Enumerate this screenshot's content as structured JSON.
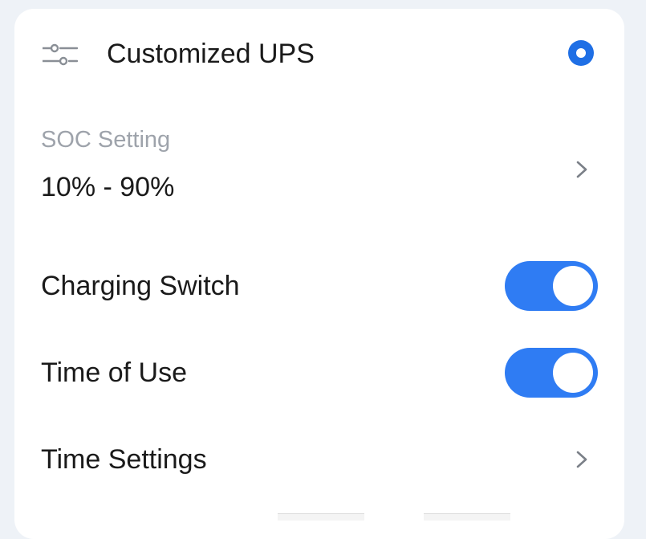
{
  "header": {
    "icon": "sliders-icon",
    "title": "Customized UPS",
    "selected": true,
    "accent_color": "#1f6fe5"
  },
  "soc": {
    "label": "SOC Setting",
    "value": "10% - 90%"
  },
  "charging_switch": {
    "label": "Charging Switch",
    "on": true
  },
  "time_of_use": {
    "label": "Time of Use",
    "on": true
  },
  "time_settings": {
    "label": "Time Settings"
  },
  "colors": {
    "toggle_on": "#2f7cf3",
    "background": "#eef2f7",
    "card": "#ffffff",
    "secondary_text": "#9ea3ab"
  }
}
